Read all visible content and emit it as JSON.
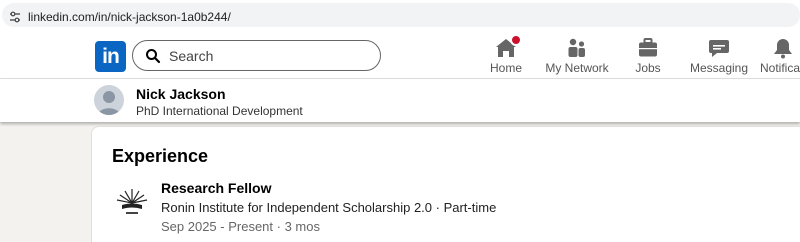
{
  "browser": {
    "url": "linkedin.com/in/nick-jackson-1a0b244/",
    "tune_icon": "site-settings-icon"
  },
  "nav": {
    "logo_text": "in",
    "search_placeholder": "Search",
    "items": [
      {
        "label": "Home",
        "icon": "home-icon",
        "has_badge": true
      },
      {
        "label": "My Network",
        "icon": "network-icon"
      },
      {
        "label": "Jobs",
        "icon": "briefcase-icon"
      },
      {
        "label": "Messaging",
        "icon": "messaging-icon"
      },
      {
        "label": "Notificati",
        "icon": "bell-icon"
      }
    ],
    "accent": "#0a66c2",
    "badge_color": "#cb112d"
  },
  "profile": {
    "name": "Nick Jackson",
    "headline": "PhD International Development"
  },
  "experience": {
    "section_title": "Experience",
    "entries": [
      {
        "title": "Research Fellow",
        "company": "Ronin Institute for Independent Scholarship 2.0 · Part-time",
        "dates": "Sep 2025 - Present · 3 mos",
        "logo_icon": "ronin-institute-logo"
      }
    ]
  }
}
